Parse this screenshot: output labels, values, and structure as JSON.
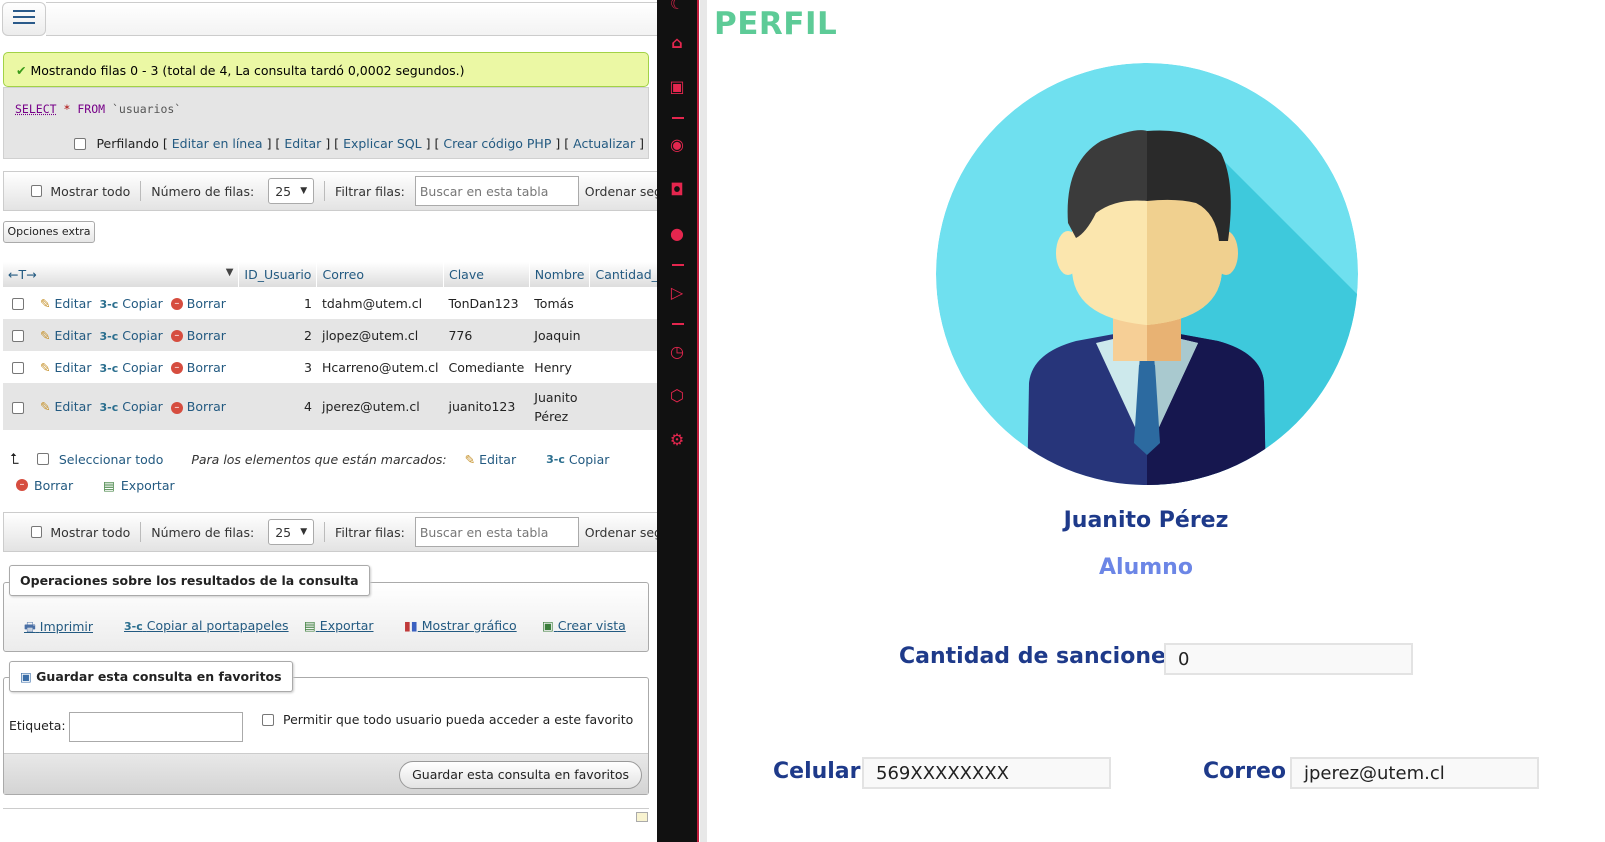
{
  "left": {
    "success_msg": "Mostrando filas 0 - 3 (total de 4, La consulta tardó 0,0002 segundos.)",
    "sql": {
      "kw1": "SELECT",
      "op": "*",
      "kw2": "FROM",
      "table": "`usuarios`"
    },
    "profiling_label": "Perfilando",
    "sql_links": [
      "Editar en línea",
      "Editar",
      "Explicar SQL",
      "Crear código PHP",
      "Actualizar"
    ],
    "nav": {
      "show_all": "Mostrar todo",
      "rows_label": "Número de filas:",
      "rows_value": "25",
      "filter_label": "Filtrar filas:",
      "filter_placeholder": "Buscar en esta tabla",
      "order_label": "Ordenar seg"
    },
    "extra_options": "Opciones extra",
    "table": {
      "arrows": "←T→",
      "columns": [
        "ID_Usuario",
        "Correo",
        "Clave",
        "Nombre",
        "Cantidad_de"
      ],
      "actions": {
        "edit": "Editar",
        "copy": "Copiar",
        "delete": "Borrar"
      },
      "rows": [
        {
          "id": "1",
          "correo": "tdahm@utem.cl",
          "clave": "TonDan123",
          "nombre": "Tomás",
          "nombre2": ""
        },
        {
          "id": "2",
          "correo": "jlopez@utem.cl",
          "clave": "776",
          "nombre": "Joaquin",
          "nombre2": ""
        },
        {
          "id": "3",
          "correo": "Hcarreno@utem.cl",
          "clave": "Comediante",
          "nombre": "Henry",
          "nombre2": ""
        },
        {
          "id": "4",
          "correo": "jperez@utem.cl",
          "clave": "juanito123",
          "nombre": "Juanito",
          "nombre2": "Pérez"
        }
      ]
    },
    "bulk": {
      "select_all": "Seleccionar todo",
      "marked_label": "Para los elementos que están marcados:",
      "edit": "Editar",
      "copy": "Copiar",
      "delete": "Borrar",
      "export": "Exportar"
    },
    "ops": {
      "legend": "Operaciones sobre los resultados de la consulta",
      "print": "Imprimir",
      "clipboard": "Copiar al portapapeles",
      "export": "Exportar",
      "chart": "Mostrar gráfico",
      "view": "Crear vista"
    },
    "fav": {
      "legend": "Guardar esta consulta en favoritos",
      "label": "Etiqueta:",
      "allow": "Permitir que todo usuario pueda acceder a este favorito",
      "button": "Guardar esta consulta en favoritos"
    }
  },
  "profile": {
    "header": "PERFIL",
    "name": "Juanito Pérez",
    "role": "Alumno",
    "sanctions_label": "Cantidad de sanciones",
    "sanctions_value": "0",
    "phone_label": "Celular",
    "phone_value": "569XXXXXXXX",
    "email_label": "Correo",
    "email_value": "jperez@utem.cl"
  },
  "colors": {
    "accent_green": "#5dcb97",
    "navy": "#1e3a8a",
    "role_blue": "#6c86e6",
    "avatar_bg": "#6fe0ef",
    "sidebar_icon": "#e4264e"
  }
}
